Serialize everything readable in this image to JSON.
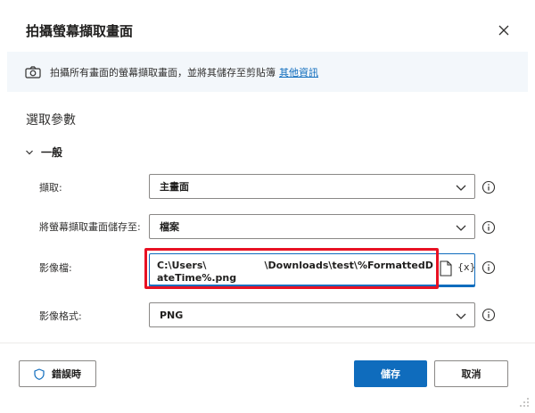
{
  "dialog": {
    "title": "拍攝螢幕擷取畫面",
    "info": {
      "text": "拍攝所有畫面的螢幕擷取畫面，並將其儲存至剪貼簿",
      "link": "其他資訊"
    },
    "section_title": "選取參數",
    "group_label": "一般",
    "fields": {
      "capture": {
        "label": "擷取:",
        "value": "主畫面"
      },
      "save_to": {
        "label": "將螢幕擷取畫面儲存至:",
        "value": "檔案"
      },
      "image_file": {
        "label": "影像檔:",
        "value": "C:\\Users\\                 \\Downloads\\test\\%FormattedDateTime%.png",
        "var_button": "{x}"
      },
      "image_format": {
        "label": "影像格式:",
        "value": "PNG"
      }
    },
    "buttons": {
      "on_error": "錯誤時",
      "save": "儲存",
      "cancel": "取消"
    }
  },
  "colors": {
    "accent": "#0f6cbd",
    "highlight": "#e81123",
    "info_bar_bg": "#f3f7fb"
  }
}
